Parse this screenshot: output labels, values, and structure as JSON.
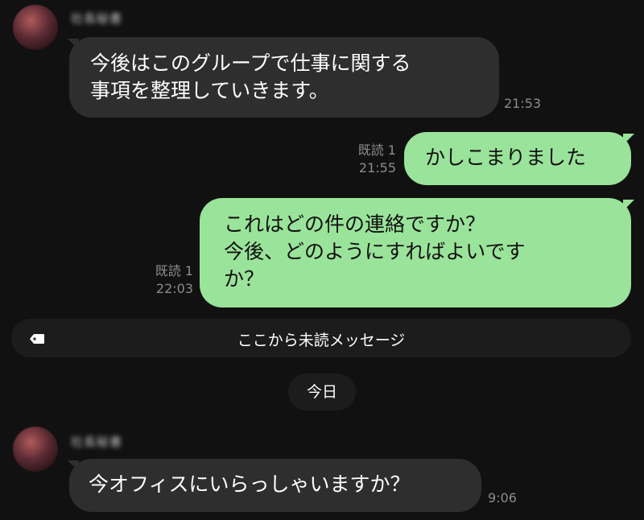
{
  "messages": [
    {
      "sender_name": "社長秘書",
      "lines": [
        "今後はこのグループで仕事に関する",
        "事項を整理していきます。"
      ],
      "time": "21:53"
    },
    {
      "read_label": "既読 1",
      "time": "21:55",
      "lines": [
        "かしこまりました"
      ]
    },
    {
      "read_label": "既読 1",
      "time": "22:03",
      "lines": [
        "これはどの件の連絡ですか？",
        "今後、どのようにすればよいです",
        "か？"
      ]
    },
    {
      "sender_name": "社長秘書",
      "lines": [
        "今オフィスにいらっしゃいますか？"
      ],
      "time": "9:06"
    }
  ],
  "unread_divider": {
    "icon": "tag-icon",
    "label": "ここから未読メッセージ"
  },
  "date_divider": {
    "label": "今日"
  },
  "colors": {
    "background": "#111111",
    "incoming_bubble": "#2e2e2e",
    "outgoing_bubble": "#9ae39a",
    "meta_text": "#8c8c8c"
  }
}
